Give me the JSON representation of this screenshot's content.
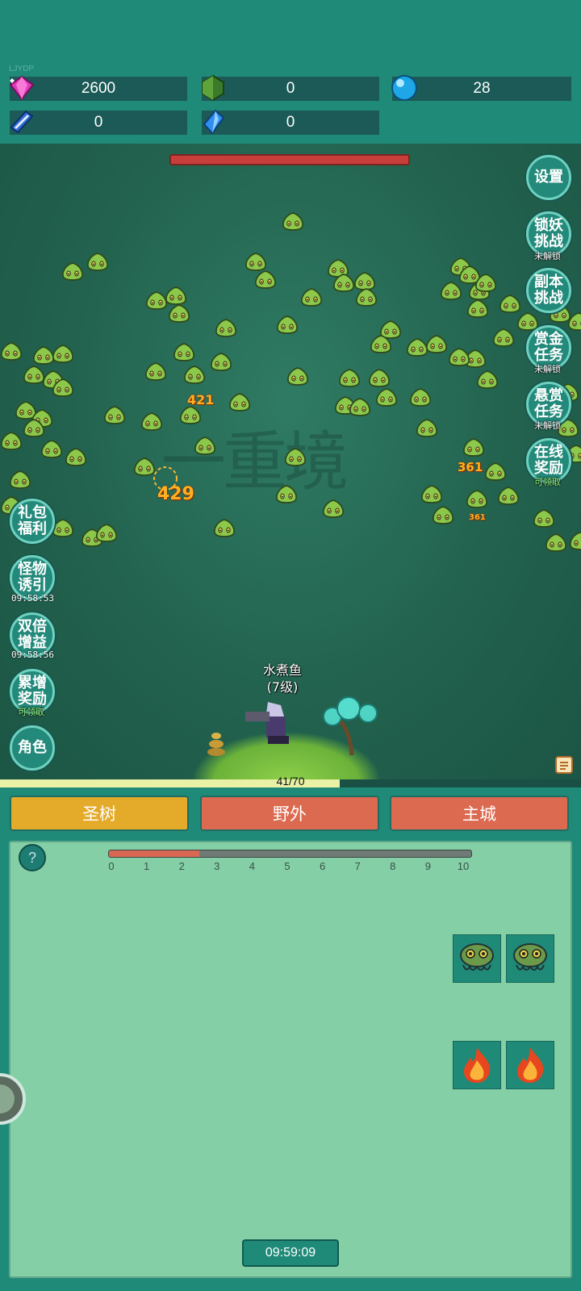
{
  "header": {
    "small_tag": "LJYDP",
    "resources": [
      {
        "name": "gem",
        "icon": "pink-gem-icon",
        "value": "2600"
      },
      {
        "name": "emerald",
        "icon": "green-crystal-icon",
        "value": "0"
      },
      {
        "name": "orb",
        "icon": "blue-orb-icon",
        "value": "28"
      },
      {
        "name": "book",
        "icon": "blue-book-icon",
        "value": "0"
      },
      {
        "name": "crystal",
        "icon": "blue-crystal-icon",
        "value": "0"
      }
    ]
  },
  "battle": {
    "realm_text": "一重境",
    "player": {
      "name": "水煮鱼",
      "level": "(7级)"
    },
    "damage_numbers": [
      "421",
      "429",
      "361",
      "361"
    ],
    "xp_text": "41/70",
    "xp_fraction": 0.585
  },
  "left_menu": [
    {
      "label": "礼包\n福利",
      "sub": ""
    },
    {
      "label": "怪物\n诱引",
      "sub": "09:58:53"
    },
    {
      "label": "双倍\n增益",
      "sub": "09:58:56"
    },
    {
      "label": "累增\n奖励",
      "sub": "可领取"
    },
    {
      "label": "角色",
      "sub": ""
    }
  ],
  "right_menu": [
    {
      "label": "设置",
      "sub": ""
    },
    {
      "label": "锁妖\n挑战",
      "sub": "未解锁"
    },
    {
      "label": "副本\n挑战",
      "sub": ""
    },
    {
      "label": "赏金\n任务",
      "sub": "未解锁"
    },
    {
      "label": "悬赏\n任务",
      "sub": "未解锁"
    },
    {
      "label": "在线\n奖励",
      "sub": "可领取"
    }
  ],
  "tabs": [
    "圣树",
    "野外",
    "主城"
  ],
  "colors": {
    "tab_active": "#e4aa2a",
    "tab_inactive": "#dc6a50",
    "accent": "#1f8a78"
  },
  "panel": {
    "help_label": "?",
    "progress_ticks": [
      "0",
      "1",
      "2",
      "3",
      "4",
      "5",
      "6",
      "7",
      "8",
      "9",
      "10"
    ],
    "progress_value": 2.5,
    "progress_max": 10,
    "slots": [
      {
        "icon": "slime-monster-icon"
      },
      {
        "icon": "slime-monster-icon"
      },
      {
        "icon": "fire-icon"
      },
      {
        "icon": "fire-icon"
      }
    ],
    "timer": "09:59:09"
  }
}
